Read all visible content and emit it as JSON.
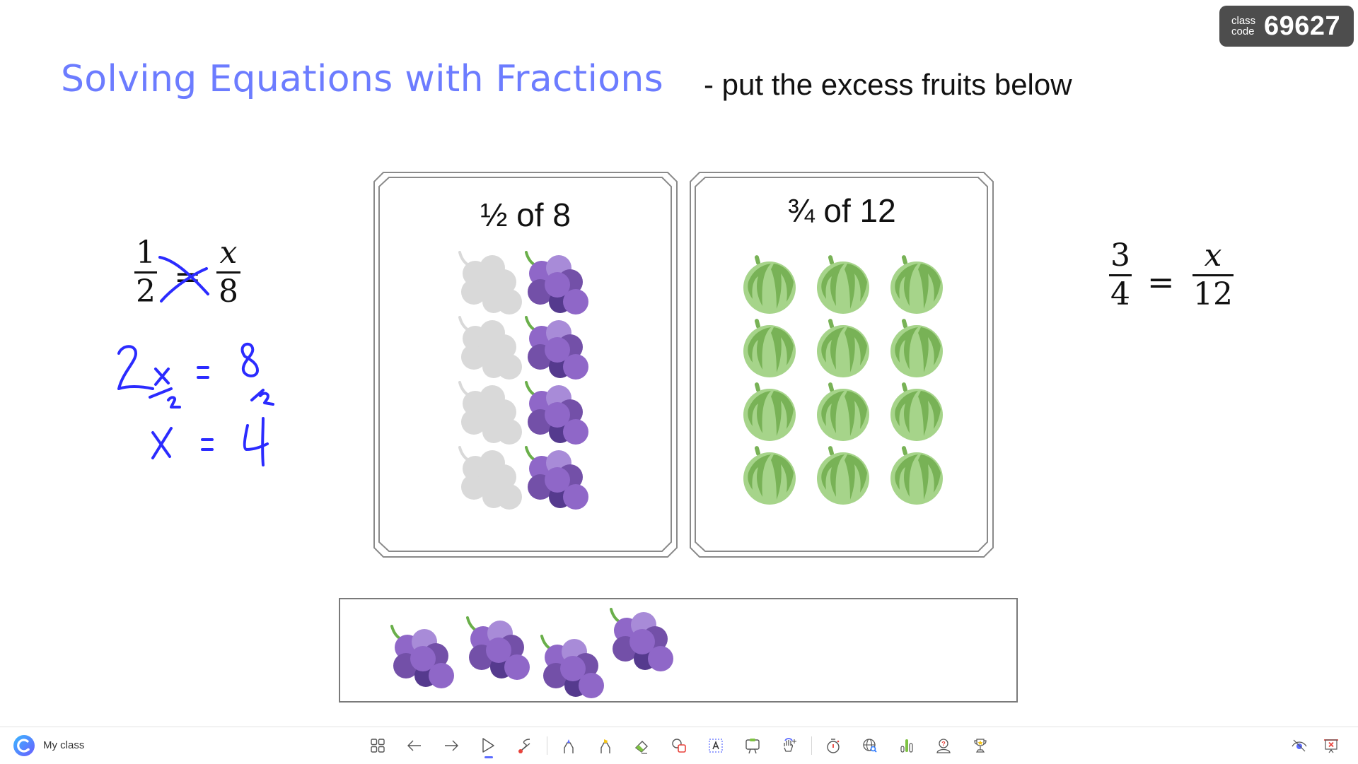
{
  "class_code": {
    "label": "class code",
    "value": "69627"
  },
  "slide": {
    "title": "Solving Equations with Fractions",
    "subtitle": "- put the excess fruits below",
    "title_color": "#6c7cff"
  },
  "left_equation": {
    "lhs": {
      "numerator": "1",
      "denominator": "2"
    },
    "equals": "=",
    "rhs": {
      "numerator": "x",
      "denominator": "8"
    },
    "annotation_color": "#2b2bff",
    "handwritten_steps": [
      "2x/2 = 8/2",
      "x = 4"
    ]
  },
  "right_equation": {
    "lhs": {
      "numerator": "3",
      "denominator": "4"
    },
    "equals": "=",
    "rhs": {
      "numerator": "x",
      "denominator": "12"
    }
  },
  "boxes": [
    {
      "title": "½ of 8",
      "fruit": "grapes",
      "total": 8,
      "colored": 4,
      "greyed": 4
    },
    {
      "title": "¾ of 12",
      "fruit": "melons",
      "total": 12,
      "colored": 12,
      "greyed": 0
    }
  ],
  "excess_area": {
    "fruit": "grapes",
    "count": 4
  },
  "colors": {
    "grape_light": "#a88bd8",
    "grape_mid": "#8f67c8",
    "grape_dark": "#7350a8",
    "grape_darkest": "#553a8e",
    "stem": "#6aaf4a",
    "melon_light": "#a6d48a",
    "melon_dark": "#78b256",
    "greyed": "#d9d9d9"
  },
  "toolbar": {
    "app_label": "My class",
    "tools": [
      {
        "name": "grid-view",
        "label": "Slides overview"
      },
      {
        "name": "previous",
        "label": "Previous"
      },
      {
        "name": "next",
        "label": "Next"
      },
      {
        "name": "select",
        "label": "Select",
        "active": true
      },
      {
        "name": "laser-pointer",
        "label": "Laser pointer"
      },
      {
        "name": "pen",
        "label": "Pen"
      },
      {
        "name": "highlighter",
        "label": "Highlighter"
      },
      {
        "name": "eraser",
        "label": "Eraser"
      },
      {
        "name": "shapes",
        "label": "Shapes"
      },
      {
        "name": "text-box",
        "label": "Text"
      },
      {
        "name": "whiteboard",
        "label": "Whiteboard"
      },
      {
        "name": "drag-hand",
        "label": "Move"
      },
      {
        "name": "timer",
        "label": "Timer"
      },
      {
        "name": "web-search",
        "label": "Web search"
      },
      {
        "name": "poll",
        "label": "Poll"
      },
      {
        "name": "random-picker",
        "label": "Random student"
      },
      {
        "name": "award",
        "label": "Award"
      },
      {
        "name": "hide-screen",
        "label": "Hide screen"
      },
      {
        "name": "end-presentation",
        "label": "End"
      }
    ]
  }
}
